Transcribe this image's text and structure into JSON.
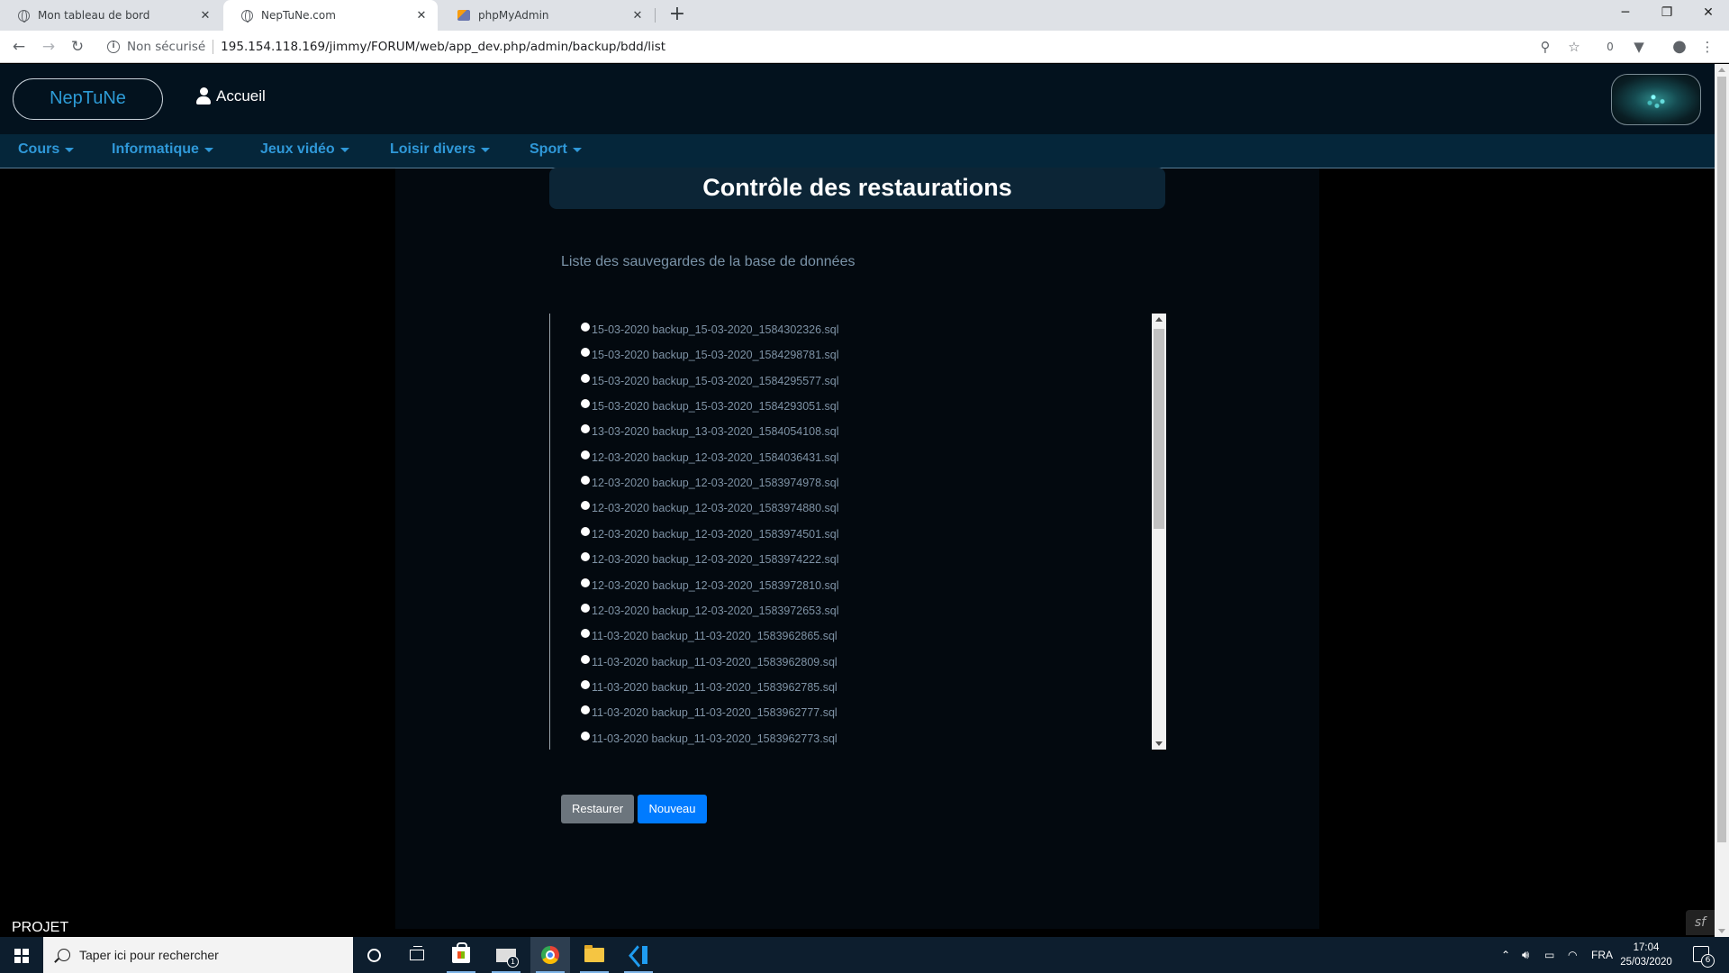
{
  "browser": {
    "tabs": [
      {
        "title": "Mon tableau de bord"
      },
      {
        "title": "NepTuNe.com"
      },
      {
        "title": "phpMyAdmin"
      }
    ],
    "security_label": "Non sécurisé",
    "url": "195.154.118.169/jimmy/FORUM/web/app_dev.php/admin/backup/bdd/list",
    "extension_badge": "0"
  },
  "site": {
    "brand": "NepTuNe",
    "home_label": "Accueil",
    "nav": [
      {
        "label": "Cours"
      },
      {
        "label": "Informatique"
      },
      {
        "label": "Jeux vidéo"
      },
      {
        "label": "Loisir divers"
      },
      {
        "label": "Sport"
      }
    ],
    "page_title": "Contrôle des restaurations",
    "subtitle": "Liste des sauvegardes de la base de données",
    "backups": [
      "15-03-2020 backup_15-03-2020_1584302326.sql",
      "15-03-2020 backup_15-03-2020_1584298781.sql",
      "15-03-2020 backup_15-03-2020_1584295577.sql",
      "15-03-2020 backup_15-03-2020_1584293051.sql",
      "13-03-2020 backup_13-03-2020_1584054108.sql",
      "12-03-2020 backup_12-03-2020_1584036431.sql",
      "12-03-2020 backup_12-03-2020_1583974978.sql",
      "12-03-2020 backup_12-03-2020_1583974880.sql",
      "12-03-2020 backup_12-03-2020_1583974501.sql",
      "12-03-2020 backup_12-03-2020_1583974222.sql",
      "12-03-2020 backup_12-03-2020_1583972810.sql",
      "12-03-2020 backup_12-03-2020_1583972653.sql",
      "11-03-2020 backup_11-03-2020_1583962865.sql",
      "11-03-2020 backup_11-03-2020_1583962809.sql",
      "11-03-2020 backup_11-03-2020_1583962785.sql",
      "11-03-2020 backup_11-03-2020_1583962777.sql",
      "11-03-2020 backup_11-03-2020_1583962773.sql"
    ],
    "restore_label": "Restaurer",
    "new_label": "Nouveau",
    "footer_label": "PROJET",
    "symfony_badge": "sf"
  },
  "taskbar": {
    "search_placeholder": "Taper ici pour rechercher",
    "mail_badge": "1",
    "language": "FRA",
    "time": "17:04",
    "date": "25/03/2020",
    "notification_count": "6"
  },
  "colors": {
    "header_bg": "#03121e",
    "nav_bg": "#05263a",
    "nav_text": "#2f98d8",
    "restore_button": "#6c757d",
    "new_button": "#007bff"
  }
}
